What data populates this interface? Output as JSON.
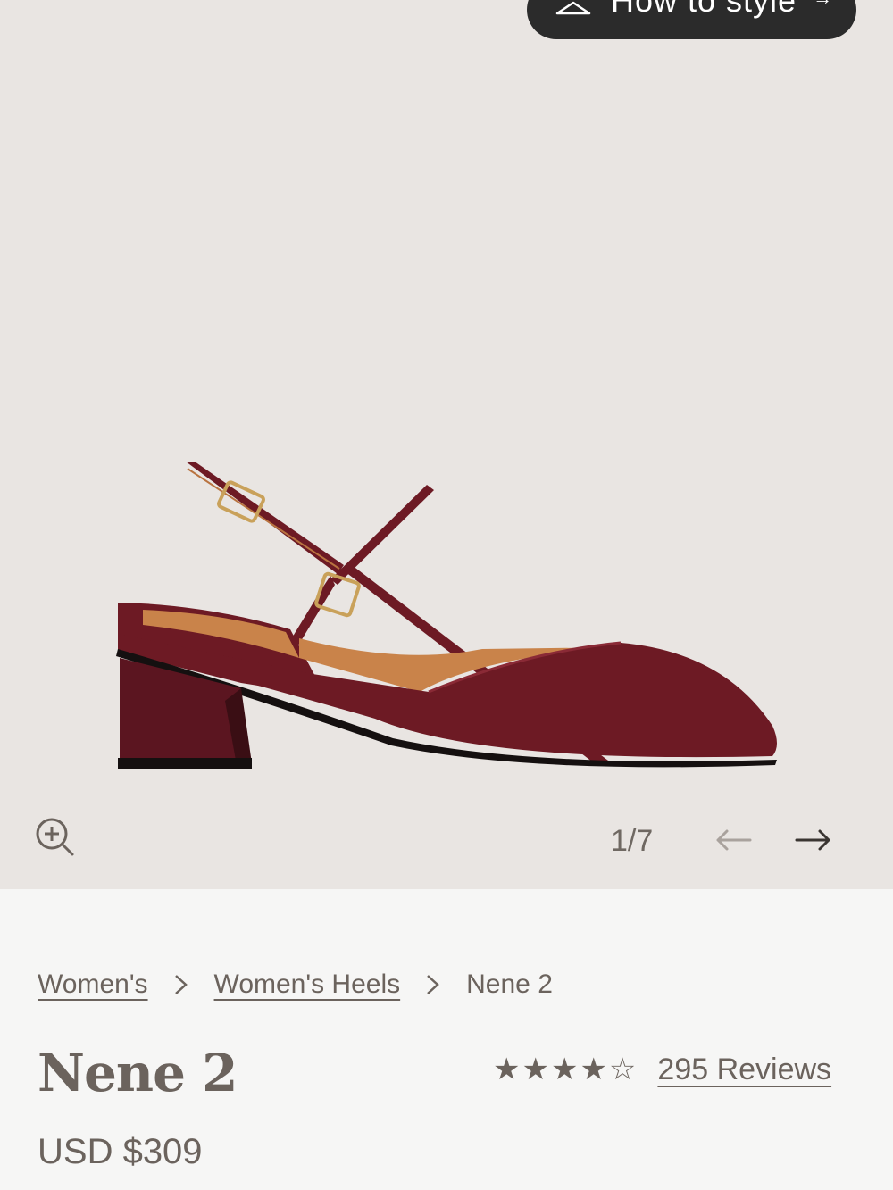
{
  "style_button": {
    "label": "How to style",
    "arrow": "→"
  },
  "gallery": {
    "counter": "1/7",
    "prev_arrow": "←",
    "next_arrow": "→"
  },
  "breadcrumb": {
    "items": [
      "Women's",
      "Women's Heels",
      "Nene 2"
    ]
  },
  "product": {
    "name": "Nene 2",
    "stars": "★★★★☆",
    "rating_fraction": 0.9,
    "reviews_label": "295 Reviews",
    "price": "USD $309"
  },
  "colors": {
    "shoe": "#6d1a24",
    "lining": "#c9834a",
    "gallery_bg": "#e9e5e2",
    "text": "#6b635d",
    "button": "#2b2b2b"
  }
}
